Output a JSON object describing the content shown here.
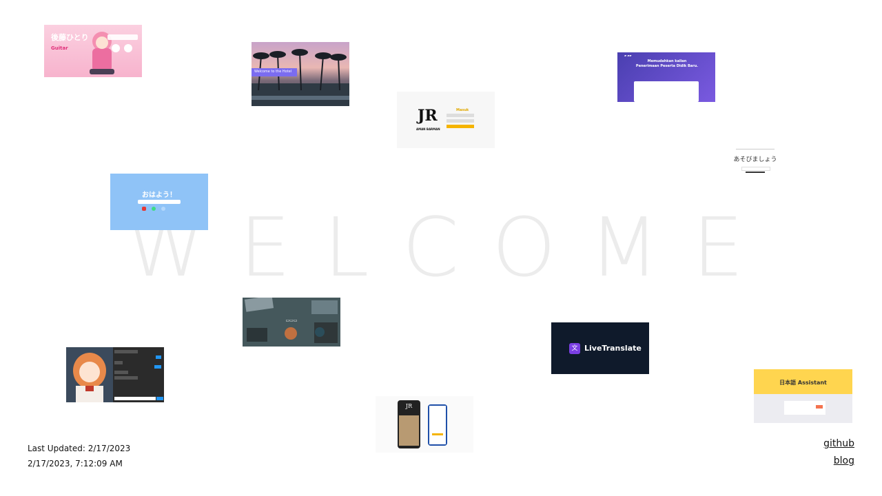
{
  "hero": {
    "title": "WELCOME"
  },
  "thumbnails": {
    "t1": {
      "name": "後藤ひとり",
      "sub": "Guitar"
    },
    "t2": {
      "banner": "Welcome to the Hotel"
    },
    "t3": {
      "brand": "AMAN BARMAN",
      "heading": "Masuk"
    },
    "t4": {
      "headline": "Memudahkan kalian\nPenerimaan Peserta Didik Baru."
    },
    "t5": {
      "text": "あそびましょう"
    },
    "t6": {
      "text": "おはよう！"
    },
    "t8": {
      "text": "LiveTranslate"
    },
    "t11": {
      "text": "日本語 Assistant"
    }
  },
  "footer": {
    "last_updated": "Last Updated: 2/17/2023",
    "datetime": "2/17/2023, 7:12:09 AM",
    "links": [
      "github",
      "blog"
    ]
  },
  "colors": {
    "welcome": "#ececec",
    "livetranslate_bg": "#0f1a2b",
    "assistant_header": "#ffd54f",
    "ohayou_bg": "#8fc3f7"
  }
}
